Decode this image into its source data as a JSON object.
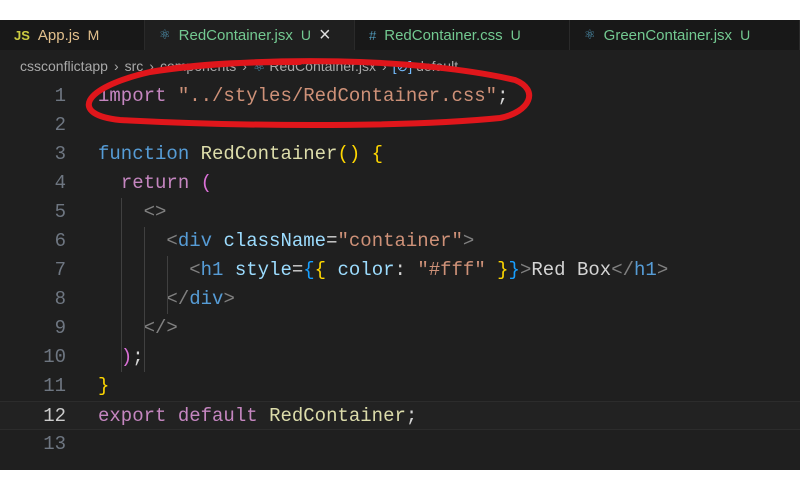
{
  "tabs": [
    {
      "icon": "JS",
      "label": "App.js",
      "status": "M",
      "labelColor": "#e2c08d",
      "iconColor": "#cbcb41",
      "active": false,
      "close": false
    },
    {
      "icon": "⚛",
      "label": "RedContainer.jsx",
      "status": "U",
      "labelColor": "#73c991",
      "iconColor": "#519aba",
      "active": true,
      "close": true
    },
    {
      "icon": "#",
      "label": "RedContainer.css",
      "status": "U",
      "labelColor": "#73c991",
      "iconColor": "#519aba",
      "active": false,
      "close": false
    },
    {
      "icon": "⚛",
      "label": "GreenContainer.jsx",
      "status": "U",
      "labelColor": "#73c991",
      "iconColor": "#519aba",
      "active": false,
      "close": false
    }
  ],
  "close_icon": "×",
  "breadcrumb": [
    "cssconflictapp",
    "src",
    "components",
    "RedContainer.jsx",
    "default"
  ],
  "current_line": 12,
  "lines": [
    [
      [
        "kw",
        "import"
      ],
      [
        "pl",
        " "
      ],
      [
        "str",
        "\"../styles/RedContainer.css\""
      ],
      [
        "pl",
        ";"
      ]
    ],
    [],
    [
      [
        "fn",
        "function"
      ],
      [
        "pl",
        " "
      ],
      [
        "nm",
        "RedContainer"
      ],
      [
        "br",
        "()"
      ],
      [
        "pl",
        " "
      ],
      [
        "br",
        "{"
      ]
    ],
    [
      [
        "pl",
        "  "
      ],
      [
        "kw",
        "return"
      ],
      [
        "pl",
        " "
      ],
      [
        "br2",
        "("
      ]
    ],
    [
      [
        "pl",
        "    "
      ],
      [
        "tg",
        "<>"
      ]
    ],
    [
      [
        "pl",
        "      "
      ],
      [
        "tg",
        "<"
      ],
      [
        "tn",
        "div"
      ],
      [
        "pl",
        " "
      ],
      [
        "at",
        "className"
      ],
      [
        "pl",
        "="
      ],
      [
        "str",
        "\"container\""
      ],
      [
        "tg",
        ">"
      ]
    ],
    [
      [
        "pl",
        "        "
      ],
      [
        "tg",
        "<"
      ],
      [
        "tn",
        "h1"
      ],
      [
        "pl",
        " "
      ],
      [
        "at",
        "style"
      ],
      [
        "pl",
        "="
      ],
      [
        "br3",
        "{"
      ],
      [
        "br",
        "{"
      ],
      [
        "pl",
        " "
      ],
      [
        "at",
        "color"
      ],
      [
        "pl",
        ": "
      ],
      [
        "str",
        "\"#fff\""
      ],
      [
        "pl",
        " "
      ],
      [
        "br",
        "}"
      ],
      [
        "br3",
        "}"
      ],
      [
        "tg",
        ">"
      ],
      [
        "pl",
        "Red Box"
      ],
      [
        "tg",
        "</"
      ],
      [
        "tn",
        "h1"
      ],
      [
        "tg",
        ">"
      ]
    ],
    [
      [
        "pl",
        "      "
      ],
      [
        "tg",
        "</"
      ],
      [
        "tn",
        "div"
      ],
      [
        "tg",
        ">"
      ]
    ],
    [
      [
        "pl",
        "    "
      ],
      [
        "tg",
        "</>"
      ]
    ],
    [
      [
        "pl",
        "  "
      ],
      [
        "br2",
        ")"
      ],
      [
        "pl",
        ";"
      ]
    ],
    [
      [
        "br",
        "}"
      ]
    ],
    [
      [
        "kw",
        "export"
      ],
      [
        "pl",
        " "
      ],
      [
        "kw",
        "default"
      ],
      [
        "pl",
        " "
      ],
      [
        "nm",
        "RedContainer"
      ],
      [
        "pl",
        ";"
      ]
    ],
    []
  ]
}
